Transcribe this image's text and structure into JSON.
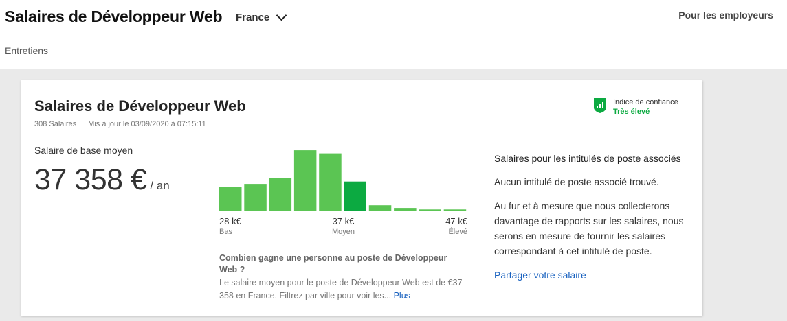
{
  "header": {
    "title": "Salaires de Développeur Web",
    "country": "France",
    "employers_link": "Pour les employeurs",
    "interviews_link": "Entretiens"
  },
  "card": {
    "title": "Salaires de Développeur Web",
    "salary_count": "308 Salaires",
    "updated": "Mis à jour le 03/09/2020 à 07:15:11",
    "confidence_label": "Indice de confiance",
    "confidence_value": "Très élevé",
    "base_label": "Salaire de base moyen",
    "amount": "37 358 €",
    "unit": "/ an"
  },
  "chart_data": {
    "type": "bar",
    "values": [
      31,
      35,
      43,
      79,
      75,
      38,
      7,
      3.5,
      1.5,
      1.5
    ],
    "highlight_index": 5,
    "ylim": [
      0,
      80
    ],
    "ticks": [
      {
        "value": "28 k€",
        "label": "Bas"
      },
      {
        "value": "37 k€",
        "label": "Moyen"
      },
      {
        "value": "47 k€",
        "label": "Élevé"
      }
    ]
  },
  "question": {
    "title": "Combien gagne une personne au poste de Développeur Web ?",
    "body": "Le salaire moyen pour le poste de Développeur Web est de €37 358 en France. Filtrez par ville pour voir les...",
    "more": "Plus"
  },
  "related": {
    "title": "Salaires pour les intitulés de poste associés",
    "none": "Aucun intitulé de poste associé trouvé.",
    "description": "Au fur et à mesure que nous collecterons davantage de rapports sur les salaires, nous serons en mesure de fournir les salaires correspondant à cet intitulé de poste.",
    "share": "Partager votre salaire"
  },
  "colors": {
    "bar": "#5bc553",
    "bar_highlight": "#0caa41",
    "link": "#1861bf"
  }
}
